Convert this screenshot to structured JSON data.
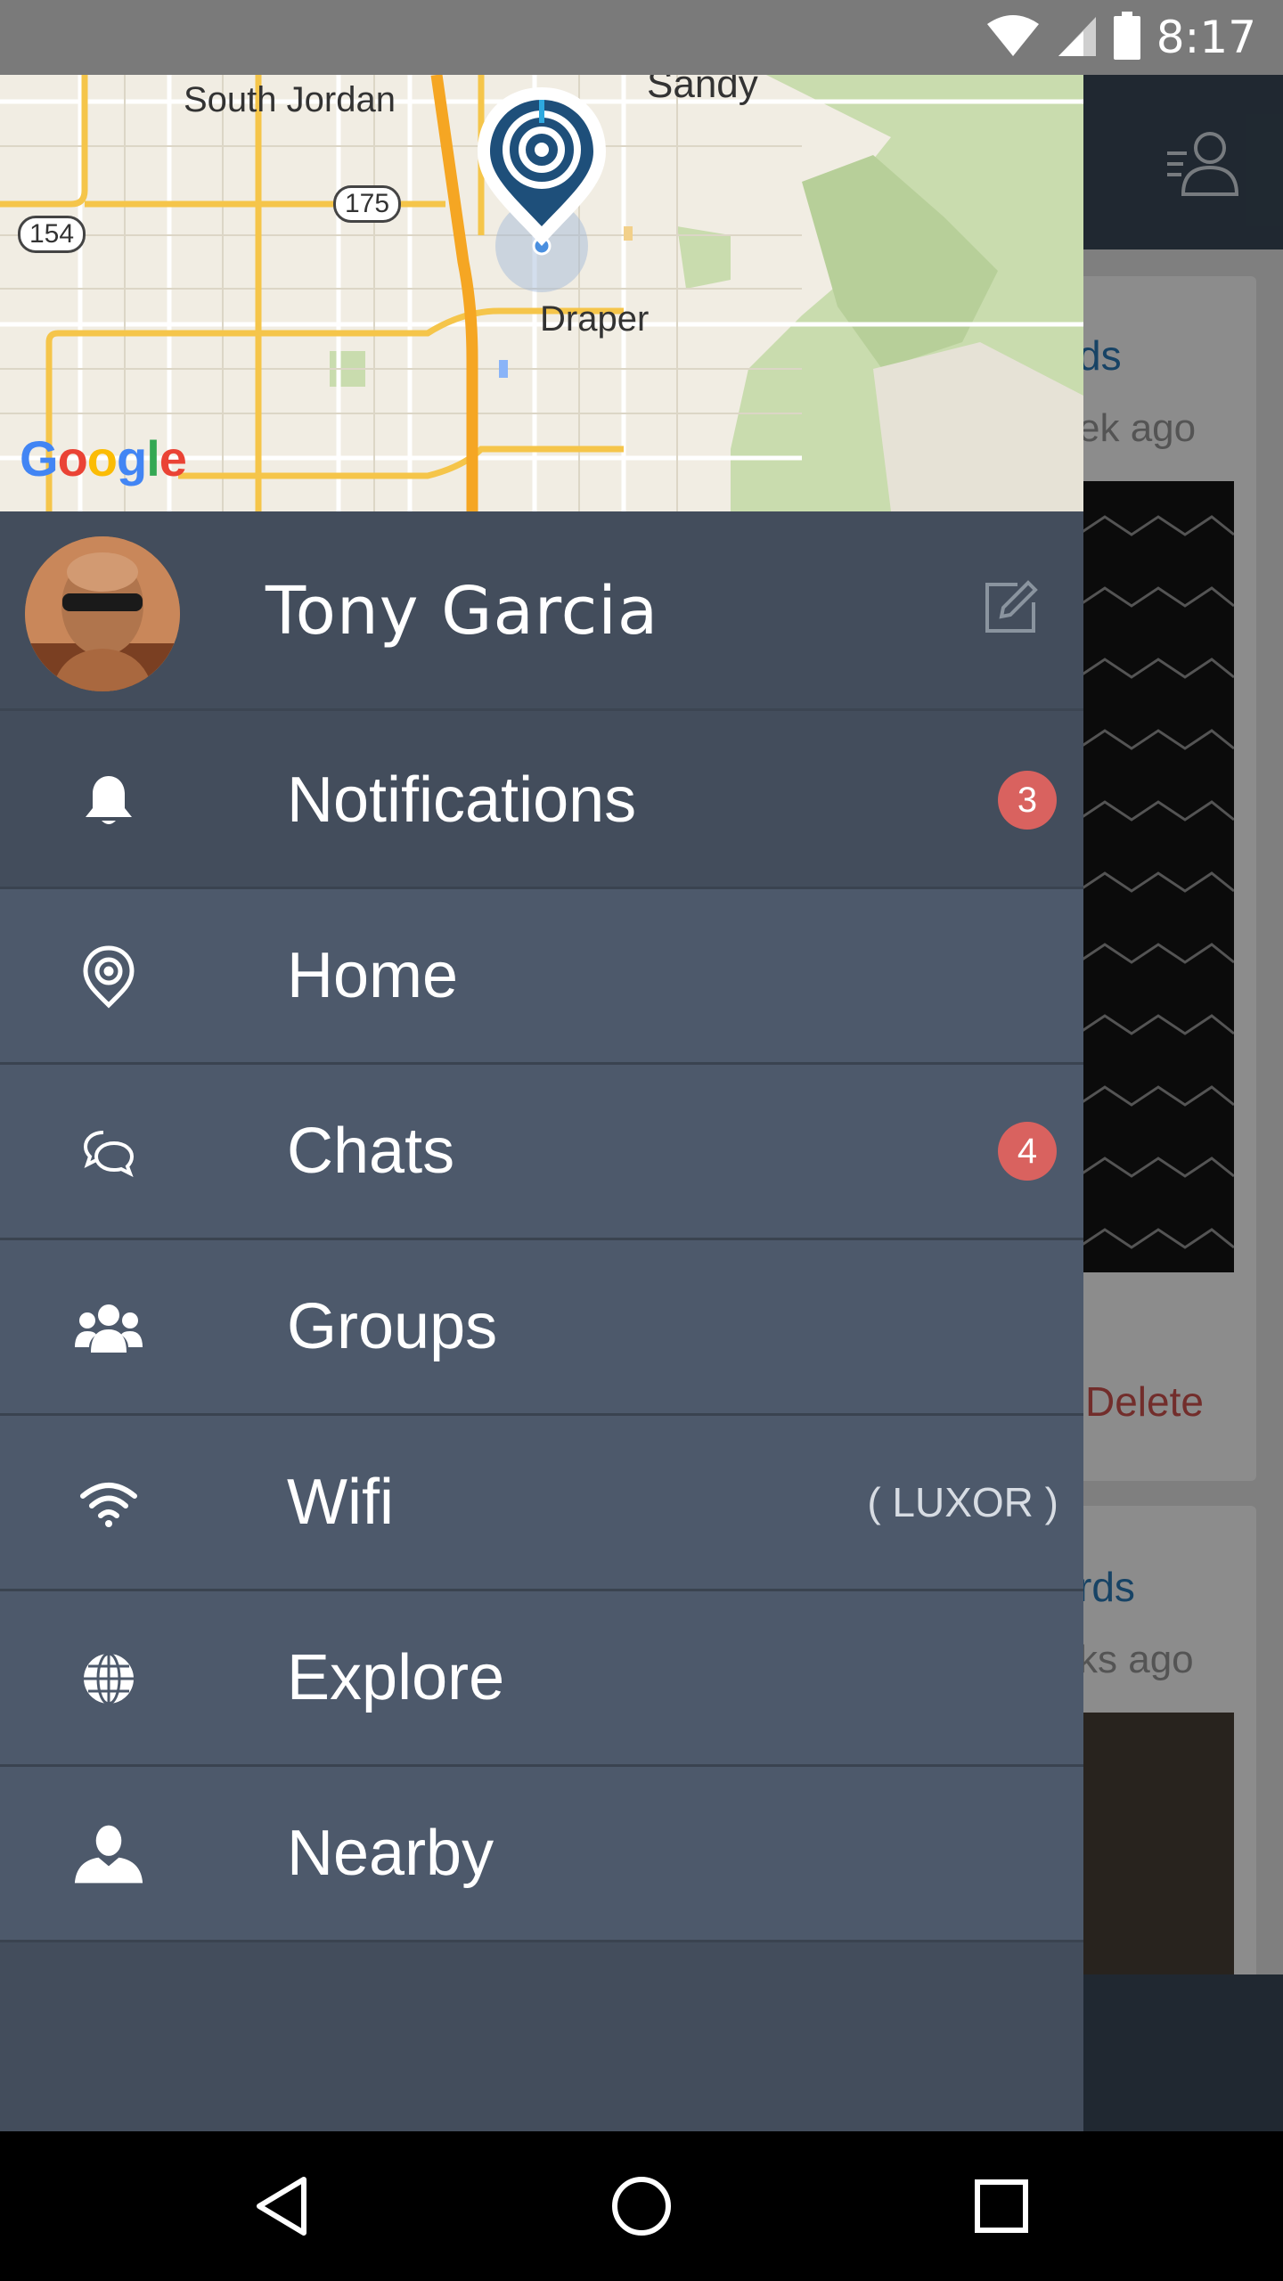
{
  "status_bar": {
    "time": "8:17"
  },
  "map": {
    "labels": [
      "South Jordan",
      "Sandy",
      "Draper"
    ],
    "route_shields": [
      "154",
      "175"
    ],
    "attribution": "Google"
  },
  "profile": {
    "name": "Tony Garcia"
  },
  "menu": {
    "items": [
      {
        "label": "Notifications",
        "icon": "bell-icon",
        "badge": "3"
      },
      {
        "label": "Home",
        "icon": "location-pin-icon"
      },
      {
        "label": "Chats",
        "icon": "chat-bubbles-icon",
        "badge": "4"
      },
      {
        "label": "Groups",
        "icon": "group-icon"
      },
      {
        "label": "Wifi",
        "icon": "wifi-icon",
        "extra": "( LUXOR )"
      },
      {
        "label": "Explore",
        "icon": "globe-icon"
      },
      {
        "label": "Nearby",
        "icon": "person-icon"
      }
    ]
  },
  "background": {
    "card1": {
      "link": "ds",
      "sub": "ek ago",
      "delete": "Delete"
    },
    "card2": {
      "link": "rds",
      "sub": "ks ago"
    }
  },
  "colors": {
    "drawer": "#434d5c",
    "drawer_item_light": "#4d596b",
    "badge": "#d9625f",
    "toolbar": "#3b4a5a"
  }
}
